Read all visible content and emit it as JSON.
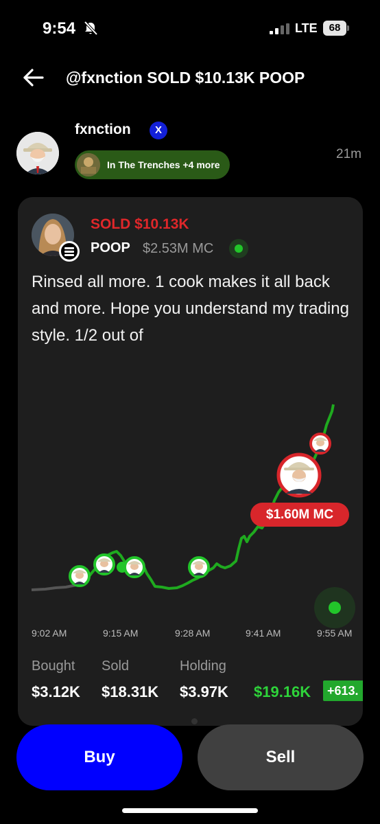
{
  "status": {
    "time": "9:54",
    "network": "LTE",
    "battery": "68",
    "icons": [
      "bell-muted-icon",
      "signal-icon",
      "battery-icon"
    ]
  },
  "header": {
    "title": "@fxnction SOLD $10.13K POOP",
    "back_icon": "arrow-left-icon"
  },
  "post": {
    "username": "fxnction",
    "verified_badge": "X",
    "tag": "In The Trenches +4 more",
    "time_ago": "21m"
  },
  "trade": {
    "action": "SOLD $10.13K",
    "ticker": "POOP",
    "market_cap": "$2.53M MC",
    "text": "Rinsed all more. 1 cook makes it all back and more. Hope you understand my trading style. 1/2 out of",
    "mc_marker": "$1.60M MC",
    "times": [
      "9:02 AM",
      "9:15 AM",
      "9:28 AM",
      "9:41 AM",
      "9:55 AM"
    ]
  },
  "stats": {
    "bought_label": "Bought",
    "bought": "$3.12K",
    "sold_label": "Sold",
    "sold": "$18.31K",
    "holding_label": "Holding",
    "holding": "$3.97K",
    "pnl": "$19.16K",
    "pnl_pct": "+613."
  },
  "actions": {
    "buy": "Buy",
    "sell": "Sell"
  },
  "colors": {
    "background": "#000000",
    "card": "#1e1e1e",
    "sold_red": "#e0272a",
    "profit_green": "#2ed33a",
    "buy_blue": "#0000ff",
    "sell_gray": "#404040",
    "tag_green": "#2a5a17"
  }
}
